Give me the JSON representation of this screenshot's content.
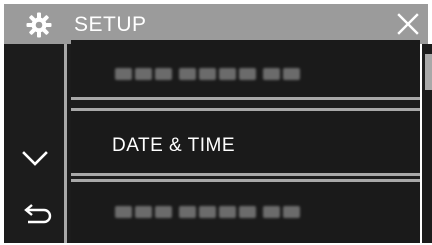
{
  "header": {
    "title": "SETUP",
    "icon": "gear-icon",
    "close_icon": "close-icon"
  },
  "nav": {
    "down_icon": "chevron-down-icon",
    "back_icon": "return-arrow-icon"
  },
  "menu": {
    "items": [
      {
        "label": "",
        "obscured": true
      },
      {
        "label": "DATE & TIME",
        "obscured": false
      },
      {
        "label": "",
        "obscured": true
      }
    ]
  },
  "colors": {
    "title_bar": "#9b9b9b",
    "panel": "#1c1c1c",
    "divider": "#a8a8a8",
    "text": "#ffffff"
  }
}
